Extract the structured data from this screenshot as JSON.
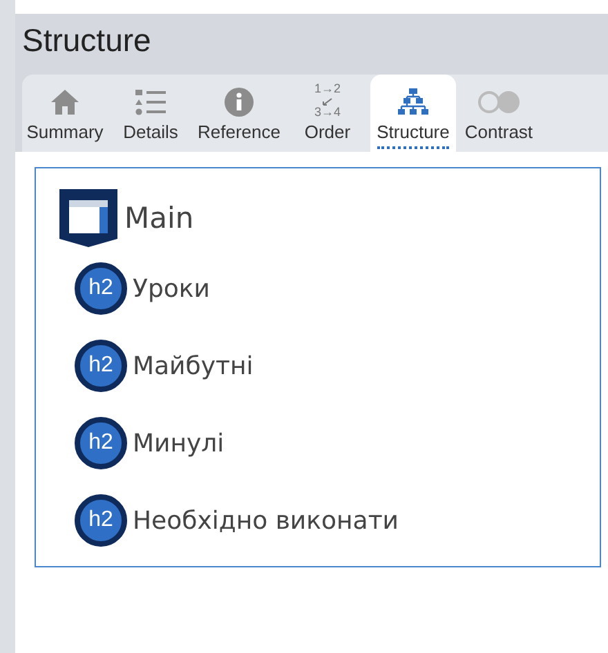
{
  "title": "Structure",
  "tabs": [
    {
      "kind": "summary",
      "label": "Summary",
      "selected": false
    },
    {
      "kind": "details",
      "label": "Details",
      "selected": false
    },
    {
      "kind": "reference",
      "label": "Reference",
      "selected": false
    },
    {
      "kind": "order",
      "label": "Order",
      "selected": false,
      "glyph_lines": [
        "1→2",
        "3→4"
      ]
    },
    {
      "kind": "structure",
      "label": "Structure",
      "selected": true
    },
    {
      "kind": "contrast",
      "label": "Contrast",
      "selected": false
    }
  ],
  "structure": [
    {
      "kind": "landmark",
      "label": "Main",
      "children": [
        {
          "kind": "heading",
          "badge": "h2",
          "label": "Уроки"
        },
        {
          "kind": "heading",
          "badge": "h2",
          "label": "Майбутні"
        },
        {
          "kind": "heading",
          "badge": "h2",
          "label": "Минулі"
        },
        {
          "kind": "heading",
          "badge": "h2",
          "label": "Необхідно виконати"
        }
      ]
    }
  ]
}
